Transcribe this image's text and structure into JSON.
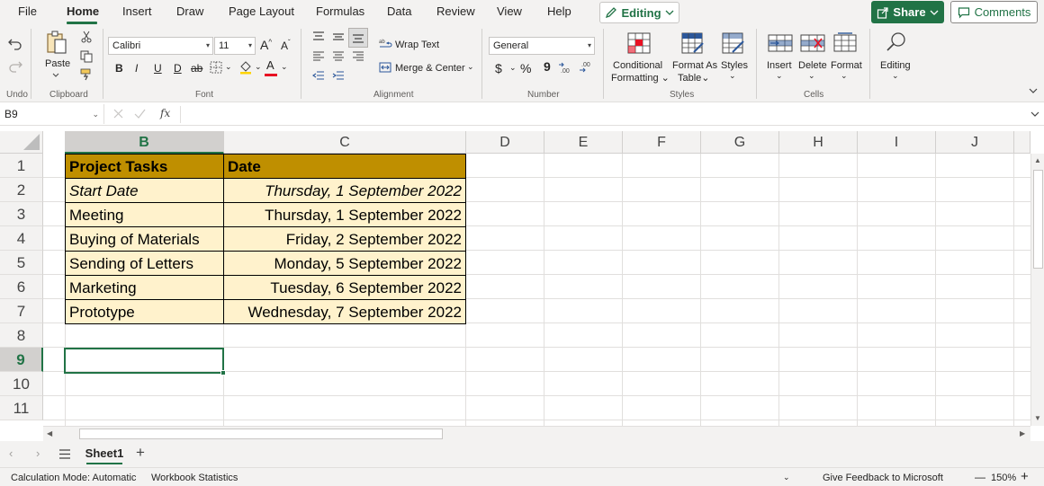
{
  "menu": {
    "tabs": [
      "File",
      "Home",
      "Insert",
      "Draw",
      "Page Layout",
      "Formulas",
      "Data",
      "Review",
      "View",
      "Help"
    ],
    "editing_label": "Editing",
    "share_label": "Share",
    "comments_label": "Comments"
  },
  "ribbon": {
    "undo_label": "Undo",
    "clipboard": {
      "paste_label": "Paste",
      "group_label": "Clipboard"
    },
    "font": {
      "family": "Calibri",
      "size": "11",
      "group_label": "Font",
      "bold": "B",
      "italic": "I",
      "underline": "U",
      "double_underline": "D",
      "strike": "ab",
      "grow": "A^",
      "shrink": "Aˇ",
      "font_color_letter": "A"
    },
    "alignment": {
      "wrap_text": "Wrap Text",
      "merge_center": "Merge & Center",
      "group_label": "Alignment"
    },
    "number": {
      "format": "General",
      "currency": "$",
      "percent": "%",
      "comma": "9",
      "inc_decimal": ".00",
      "dec_decimal": ".00",
      "group_label": "Number"
    },
    "styles": {
      "conditional": "Conditional",
      "formatting": "Formatting",
      "format_as": "Format As",
      "table": "Table",
      "styles_label": "Styles",
      "group_label": "Styles"
    },
    "cells": {
      "insert": "Insert",
      "delete": "Delete",
      "format": "Format",
      "group_label": "Cells"
    },
    "editing": {
      "label": "Editing"
    }
  },
  "formula_bar": {
    "name_box": "B9",
    "fx": "fx",
    "formula": ""
  },
  "grid": {
    "columns": [
      "B",
      "C",
      "D",
      "E",
      "F",
      "G",
      "H",
      "I",
      "J"
    ],
    "rows": [
      "1",
      "2",
      "3",
      "4",
      "5",
      "6",
      "7",
      "8",
      "9",
      "10",
      "11"
    ],
    "selected_cell": "B9",
    "table": {
      "headers": [
        "Project Tasks",
        "Date"
      ],
      "rows": [
        [
          "Start Date",
          "Thursday, 1 September 2022"
        ],
        [
          "Meeting",
          "Thursday, 1 September 2022"
        ],
        [
          "Buying of Materials",
          "Friday, 2 September 2022"
        ],
        [
          "Sending of Letters",
          "Monday, 5 September 2022"
        ],
        [
          "Marketing",
          "Tuesday, 6 September 2022"
        ],
        [
          "Prototype",
          "Wednesday, 7 September 2022"
        ]
      ]
    }
  },
  "sheets": {
    "tabs": [
      "Sheet1"
    ],
    "add": "+"
  },
  "status": {
    "calc_mode": "Calculation Mode: Automatic",
    "workbook_stats": "Workbook Statistics",
    "feedback": "Give Feedback to Microsoft",
    "zoom_minus": "—",
    "zoom": "150%",
    "zoom_plus": "+"
  },
  "colors": {
    "accent": "#217346",
    "header_fill": "#bf8f00",
    "body_fill": "#fff2cc"
  }
}
